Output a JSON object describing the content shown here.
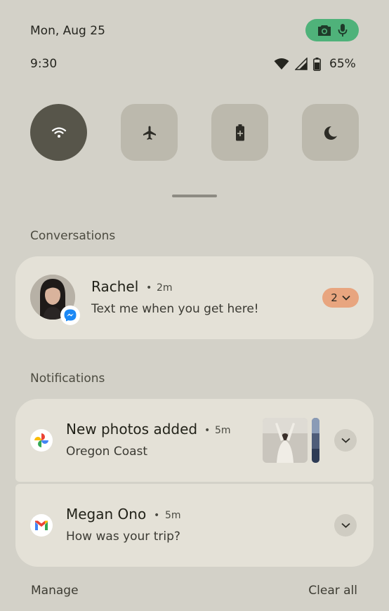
{
  "status": {
    "date": "Mon, Aug 25",
    "time": "9:30",
    "battery_percent": "65%",
    "privacy_indicators": [
      "camera-icon",
      "microphone-icon"
    ],
    "privacy_color": "#4fb27a"
  },
  "quick_tiles": [
    {
      "name": "wifi",
      "icon": "wifi-icon",
      "active": true
    },
    {
      "name": "airplane-mode",
      "icon": "airplane-icon",
      "active": false
    },
    {
      "name": "battery-saver",
      "icon": "battery-saver-icon",
      "active": false
    },
    {
      "name": "dark-theme",
      "icon": "moon-icon",
      "active": false
    }
  ],
  "conversations": {
    "section_title": "Conversations",
    "items": [
      {
        "sender": "Rachel",
        "time": "2m",
        "message": "Text me when you get here!",
        "count": "2",
        "app_icon": "messenger-icon"
      }
    ]
  },
  "notifications": {
    "section_title": "Notifications",
    "items": [
      {
        "title": "New photos added",
        "time": "5m",
        "body": "Oregon Coast",
        "app_icon": "google-photos-icon"
      },
      {
        "title": "Megan Ono",
        "time": "5m",
        "body": "How was your trip?",
        "app_icon": "gmail-icon"
      }
    ]
  },
  "footer": {
    "manage_label": "Manage",
    "clear_all_label": "Clear all"
  },
  "colors": {
    "background": "#d3d1c8",
    "card": "#e4e1d7",
    "active_tile": "#57554a",
    "inactive_tile": "#bcb9ad",
    "count_chip": "#e8a57f"
  }
}
